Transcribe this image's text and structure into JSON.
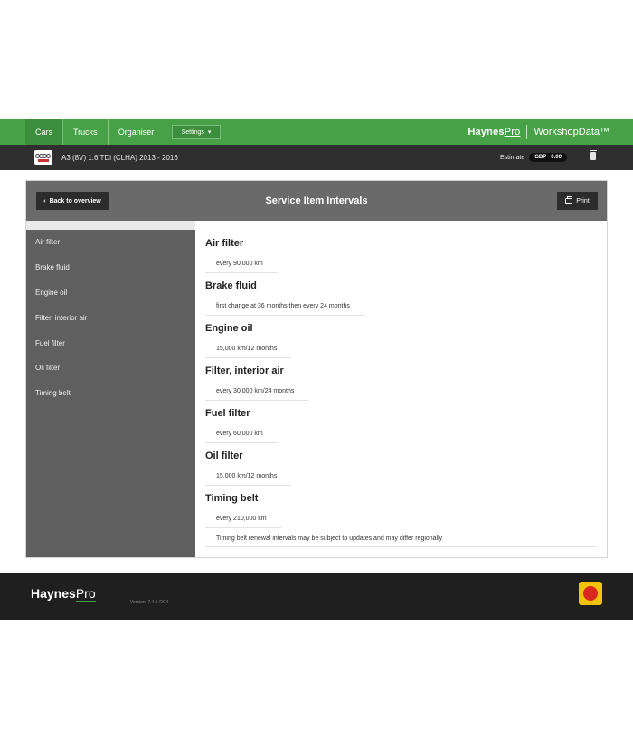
{
  "nav": {
    "tabs": [
      {
        "label": "Cars"
      },
      {
        "label": "Trucks"
      },
      {
        "label": "Organiser"
      }
    ],
    "settings_label": "Settings",
    "brand": {
      "haynes": "Haynes",
      "pro": "Pro",
      "product": "WorkshopData™"
    }
  },
  "vehicle": {
    "name": "A3 (8V) 1.6 TDi (CLHA) 2013 - 2016",
    "estimate_label": "Estimate",
    "currency": "GBP",
    "amount": "0.00"
  },
  "panel": {
    "back_label": "Back to overview",
    "title": "Service Item Intervals",
    "print_label": "Print"
  },
  "sidebar": {
    "items": [
      {
        "label": "Air filter"
      },
      {
        "label": "Brake fluid"
      },
      {
        "label": "Engine oil"
      },
      {
        "label": "Filter, interior air"
      },
      {
        "label": "Fuel filter"
      },
      {
        "label": "Oil filter"
      },
      {
        "label": "Timing belt"
      }
    ]
  },
  "intervals": [
    {
      "title": "Air filter",
      "detail": "every 90,000 km"
    },
    {
      "title": "Brake fluid",
      "detail": "first change at 36 months then every 24 months"
    },
    {
      "title": "Engine oil",
      "detail": "15,000 km/12 months"
    },
    {
      "title": "Filter, interior air",
      "detail": "every 30,000 km/24 months"
    },
    {
      "title": "Fuel filter",
      "detail": "every 60,000 km"
    },
    {
      "title": "Oil filter",
      "detail": "15,000 km/12 months"
    },
    {
      "title": "Timing belt",
      "detail": "every 210,000 km"
    }
  ],
  "timing_belt_note": "Timing belt renewal intervals may be subject to updates and may differ regionally",
  "footer": {
    "logo_haynes": "Haynes",
    "logo_pro": "Pro",
    "version": "Version: 7.4.5-RC4"
  }
}
